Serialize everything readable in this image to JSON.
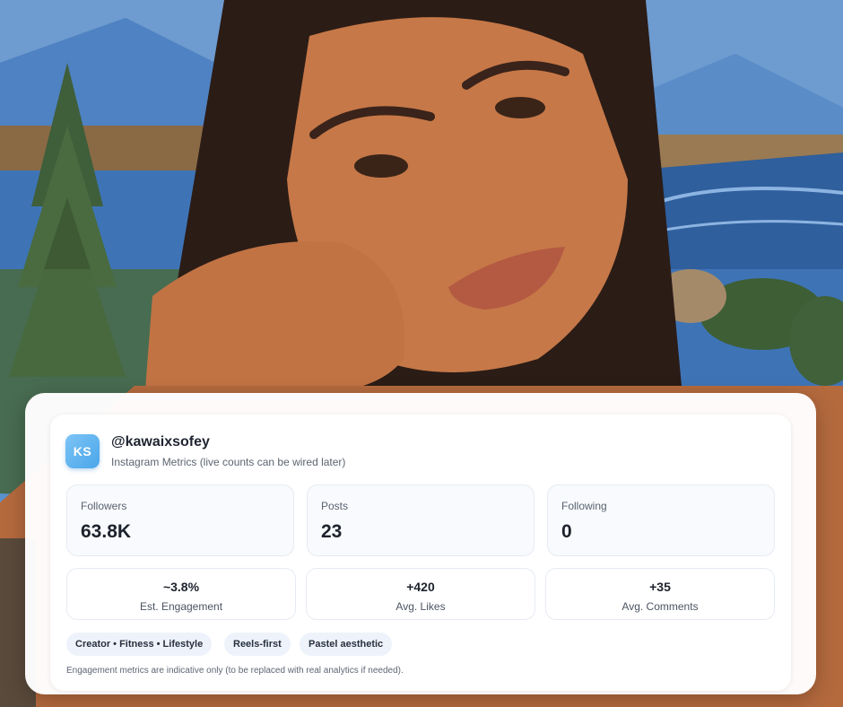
{
  "profile": {
    "initials": "KS",
    "handle": "@kawaixsofey",
    "subtitle": "Instagram Metrics (live counts can be wired later)"
  },
  "stats": [
    {
      "label": "Followers",
      "value": "63.8K"
    },
    {
      "label": "Posts",
      "value": "23"
    },
    {
      "label": "Following",
      "value": "0"
    }
  ],
  "metrics": [
    {
      "value": "~3.8%",
      "label": "Est. Engagement"
    },
    {
      "value": "+420",
      "label": "Avg. Likes"
    },
    {
      "value": "+35",
      "label": "Avg. Comments"
    }
  ],
  "tags": [
    "Creator • Fitness • Lifestyle",
    "Reels-first",
    "Pastel aesthetic"
  ],
  "footnote": "Engagement metrics are indicative only (to be replaced with real analytics if needed).",
  "colors": {
    "avatar_gradient_start": "#7cc4f6",
    "avatar_gradient_end": "#4aa6ea",
    "tag_background": "#eef3fb",
    "card_background": "#ffffff"
  }
}
